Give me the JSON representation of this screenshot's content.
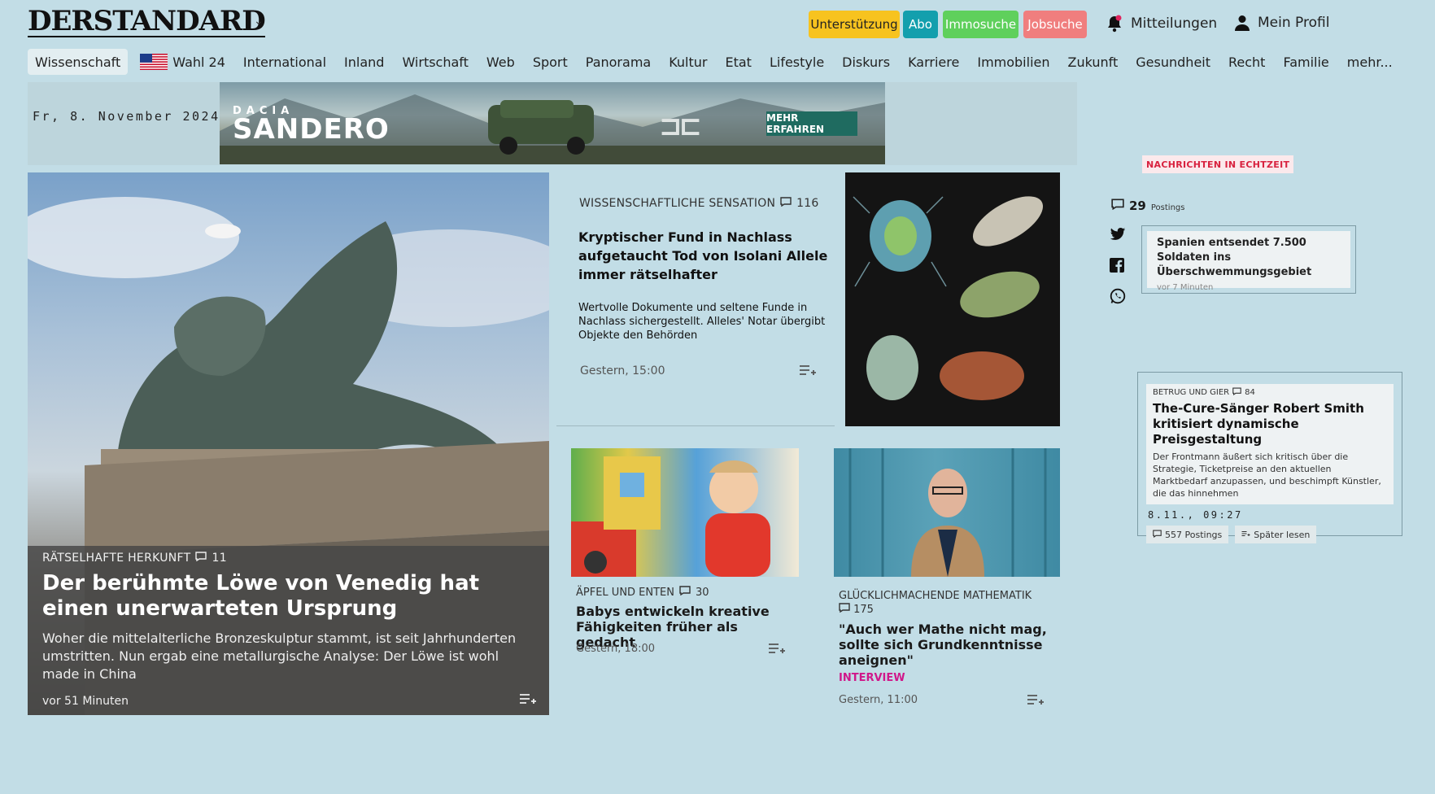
{
  "header": {
    "logo": "DERSTANDARD",
    "buttons": {
      "support": "Unterstützung",
      "abo": "Abo",
      "immo": "Immosuche",
      "jobs": "Jobsuche"
    },
    "notifications": "Mitteilungen",
    "profile": "Mein Profil"
  },
  "nav": {
    "items": [
      "Wissenschaft",
      "Wahl 24",
      "International",
      "Inland",
      "Wirtschaft",
      "Web",
      "Sport",
      "Panorama",
      "Kultur",
      "Etat",
      "Lifestyle",
      "Diskurs",
      "Karriere",
      "Immobilien",
      "Zukunft",
      "Gesundheit",
      "Recht",
      "Familie",
      "mehr..."
    ]
  },
  "date": "Fr, 8. November 2024",
  "ad": {
    "brand_small": "DACIA",
    "brand_big": "SANDERO",
    "cta": "MEHR ERFAHREN"
  },
  "hero": {
    "kicker": "RÄTSELHAFTE HERKUNFT",
    "comments": "11",
    "title": "Der berühmte Löwe von Venedig hat einen unerwarteten Ursprung",
    "lead": "Woher die mittelalterliche Bronzeskulptur stammt, ist seit Jahrhunderten umstritten. Nun ergab eine metallurgische Analyse: Der Löwe ist wohl made in China",
    "time": "vor 51 Minuten"
  },
  "article2": {
    "kicker": "WISSENSCHAFTLICHE SENSATION",
    "comments": "116",
    "title": "Kryptischer Fund in Nachlass aufgetaucht Tod von Isolani Allele immer rätselhafter",
    "lead": "Wertvolle Dokumente und seltene Funde in Nachlass sichergestellt. Alleles' Notar übergibt Objekte den Behörden",
    "time": "Gestern, 15:00"
  },
  "article3": {
    "kicker": "ÄPFEL UND ENTEN",
    "comments": "30",
    "title": "Babys entwickeln kreative Fähigkeiten früher als gedacht",
    "time": "Gestern, 18:00"
  },
  "article4": {
    "kicker": "GLÜCKLICHMACHENDE MATHEMATIK",
    "comments": "175",
    "title": "\"Auch wer Mathe nicht mag, sollte sich Grundkenntnisse aneignen\"",
    "tag": "INTERVIEW",
    "time": "Gestern, 11:00"
  },
  "sidebar": {
    "live_badge": "NACHRICHTEN IN ECHTZEIT",
    "postings_count": "29",
    "postings_label": "Postings",
    "live_title": "Spanien entsendet 7.500 Soldaten ins Überschwemmungsgebiet",
    "live_time": "vor 7 Minuten",
    "card": {
      "kicker": "BETRUG UND GIER",
      "comments": "84",
      "title": "The-Cure-Sänger Robert Smith kritisiert dynamische Preisgestaltung",
      "lead": "Der Frontmann äußert sich kritisch über die Strategie, Ticketpreise an den aktuellen Marktbedarf anzupassen, und beschimpft Künstler, die das hinnehmen",
      "time": "8.11., 09:27",
      "postings_btn": "557 Postings",
      "later_btn": "Später lesen"
    }
  },
  "colors": {
    "background": "#c2dde6",
    "support": "#f7c31f",
    "abo": "#139fad",
    "immo": "#5fd05c",
    "jobs": "#f07e7e",
    "interview": "#d0178a",
    "live": "#d8223f"
  }
}
